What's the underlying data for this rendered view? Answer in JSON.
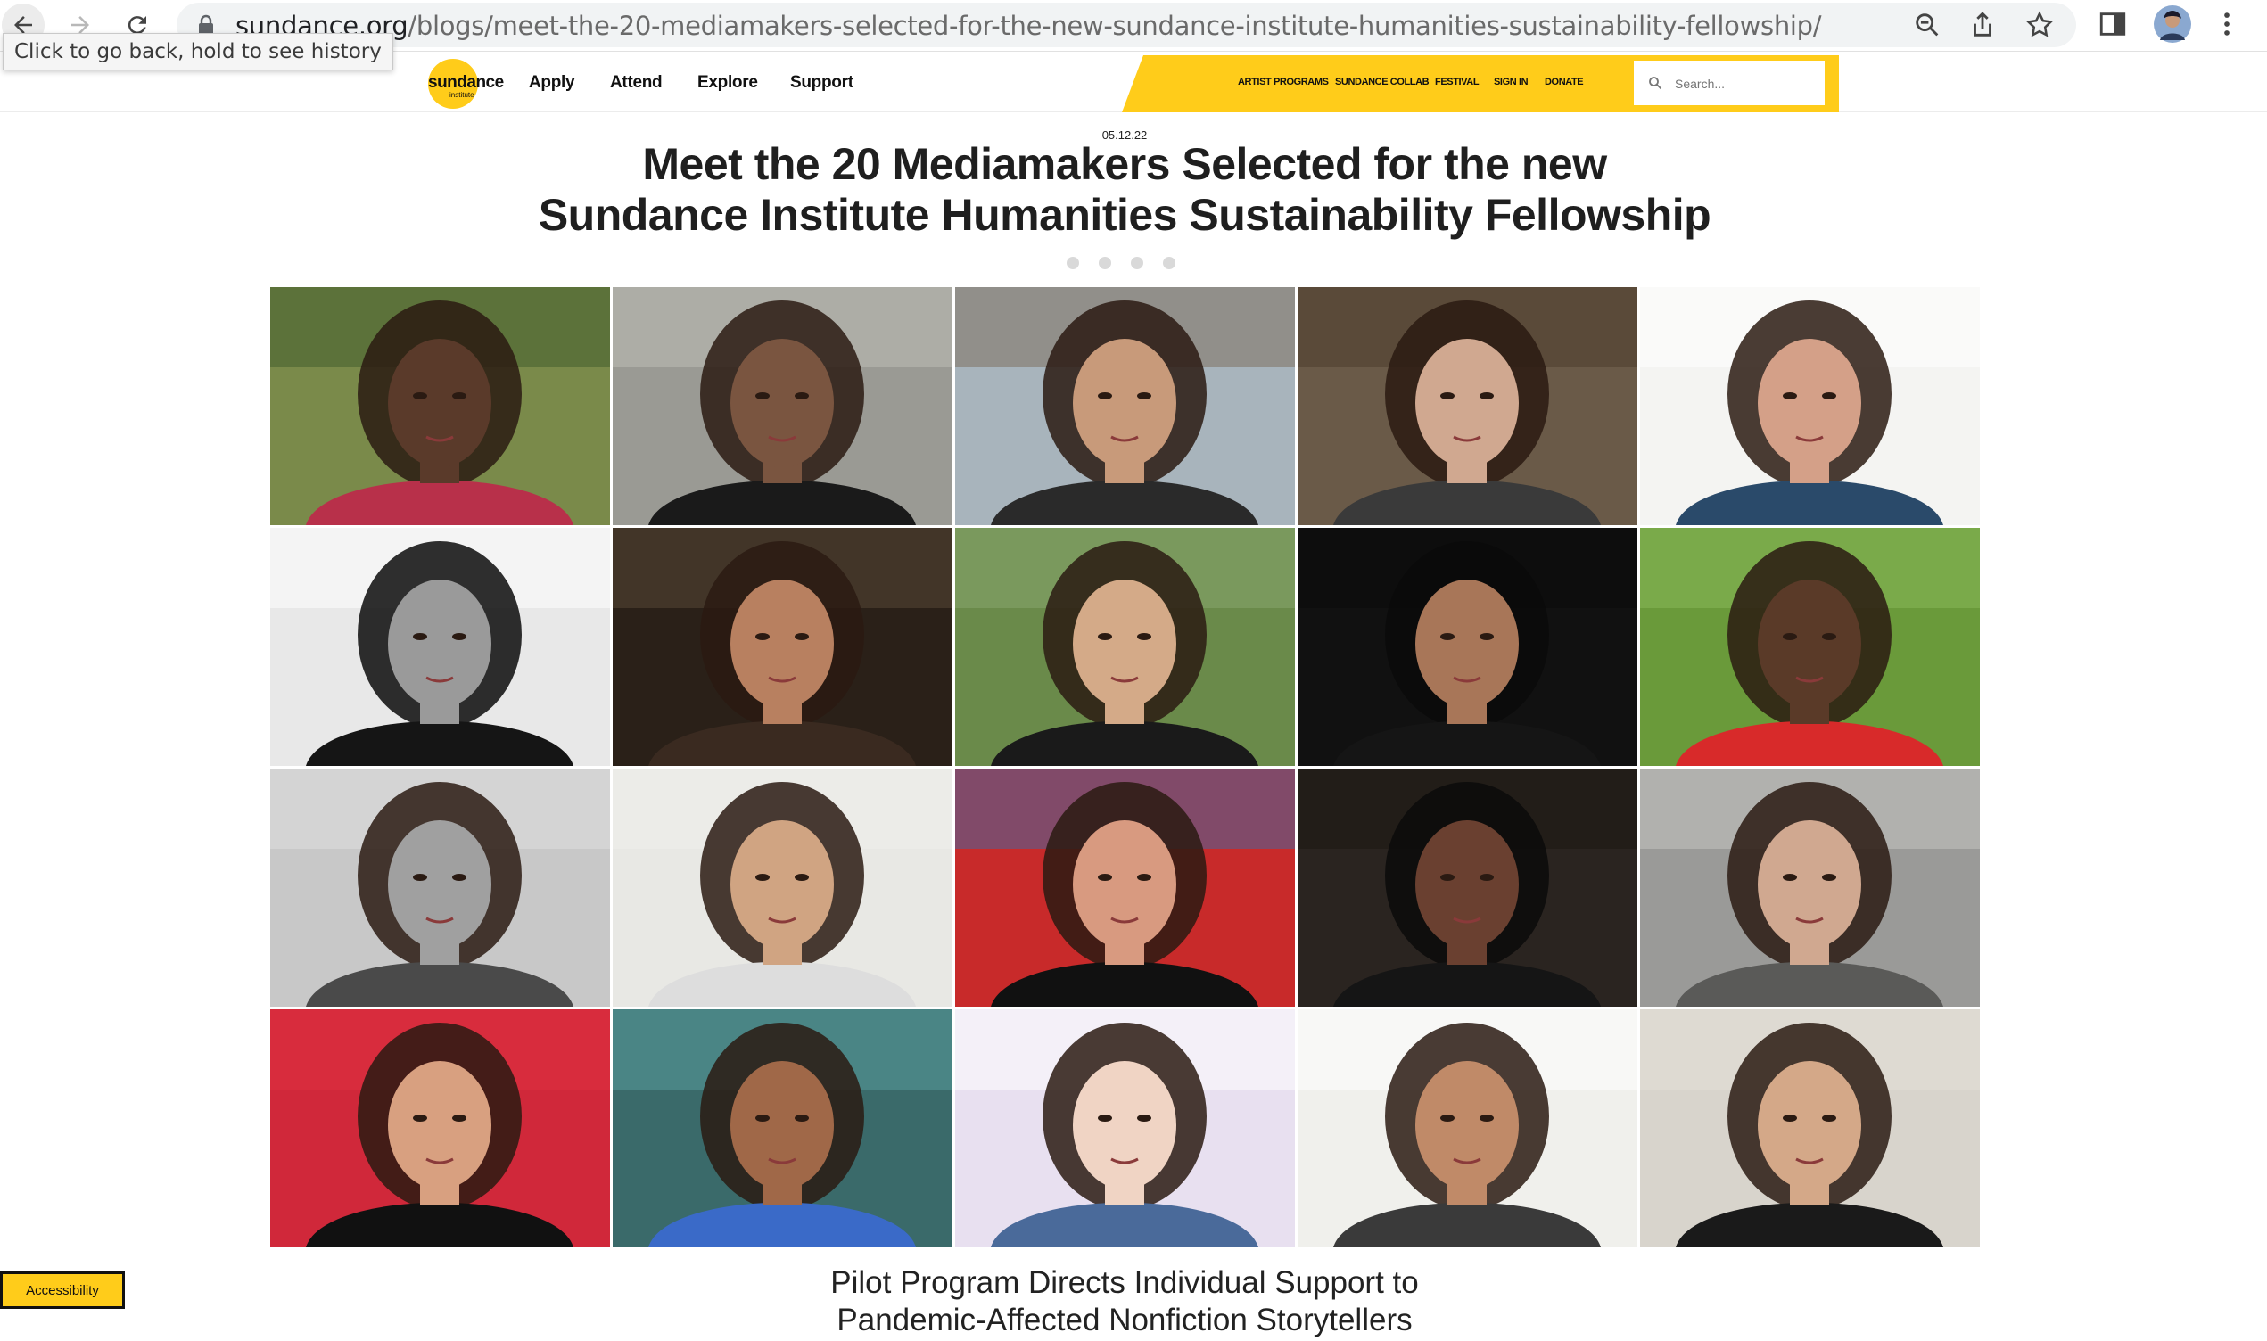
{
  "browser": {
    "url_host": "sundance.org",
    "url_path": "/blogs/meet-the-20-mediamakers-selected-for-the-new-sundance-institute-humanities-sustainability-fellowship/",
    "tooltip": "Click to go back, hold to see history"
  },
  "site": {
    "logo": "sundance",
    "logo_sub": "institute",
    "main_nav": [
      "Apply",
      "Attend",
      "Explore",
      "Support"
    ],
    "util_nav": [
      "ARTIST PROGRAMS",
      "SUNDANCE COLLAB",
      "FESTIVAL",
      "SIGN IN",
      "DONATE"
    ],
    "search_placeholder": "Search...",
    "accent_color": "#ffcc1a"
  },
  "article": {
    "date": "05.12.22",
    "title_line1": "Meet the 20 Mediamakers Selected for the new",
    "title_line2": "Sundance Institute Humanities Sustainability Fellowship",
    "share_icons": [
      "facebook-icon",
      "twitter-icon",
      "email-icon",
      "pinterest-icon"
    ],
    "subheading_line1": "Pilot Program Directs Individual Support to",
    "subheading_line2": "Pandemic-Affected Nonfiction Storytellers"
  },
  "photos": [
    {
      "bg": "#7a8a4a",
      "fg": "#5a3a2a",
      "top": "#3e5a2a",
      "shirt": "#b8304a"
    },
    {
      "bg": "#9a9a94",
      "fg": "#7a5540",
      "top": "#c0c0b8",
      "shirt": "#1a1a1a"
    },
    {
      "bg": "#a8b4bc",
      "fg": "#c89a7a",
      "top": "#7a6a58",
      "shirt": "#2a2a2a"
    },
    {
      "bg": "#6a5a48",
      "fg": "#d0a890",
      "top": "#4a3a2a",
      "shirt": "#3a3a3a"
    },
    {
      "bg": "#f4f4f2",
      "fg": "#d4a088",
      "top": "#ffffff",
      "shirt": "#2a4a6a"
    },
    {
      "bg": "#e8e8e8",
      "fg": "#9a9a9a",
      "top": "#ffffff",
      "shirt": "#151515"
    },
    {
      "bg": "#2a2018",
      "fg": "#b88060",
      "top": "#5a4a38",
      "shirt": "#3a2a20"
    },
    {
      "bg": "#6a8a4a",
      "fg": "#d4aa88",
      "top": "#8aa870",
      "shirt": "#1a1a1a"
    },
    {
      "bg": "#111111",
      "fg": "#a87658",
      "top": "#0a0a0a",
      "shirt": "#151515"
    },
    {
      "bg": "#6a9a3a",
      "fg": "#5a3a28",
      "top": "#8aba5a",
      "shirt": "#d82a2a"
    },
    {
      "bg": "#c8c8c8",
      "fg": "#a0a0a0",
      "top": "#e0e0e0",
      "shirt": "#4a4a4a"
    },
    {
      "bg": "#e8e8e4",
      "fg": "#d0a482",
      "top": "#f0f0ec",
      "shirt": "#dddddd"
    },
    {
      "bg": "#c82a2a",
      "fg": "#d89a80",
      "top": "#3a6aa8",
      "shirt": "#111111"
    },
    {
      "bg": "#2a2420",
      "fg": "#6a4030",
      "top": "#1a1510",
      "shirt": "#151515"
    },
    {
      "bg": "#9a9a98",
      "fg": "#d0a890",
      "top": "#c8c8c4",
      "shirt": "#5a5a58"
    },
    {
      "bg": "#d0283a",
      "fg": "#d8a080",
      "top": "#e03040",
      "shirt": "#111111"
    },
    {
      "bg": "#3a6a6a",
      "fg": "#a06848",
      "top": "#5aa0a0",
      "shirt": "#3a6ac8"
    },
    {
      "bg": "#e8e0f0",
      "fg": "#f0d4c4",
      "top": "#ffffff",
      "shirt": "#4a6a9a"
    },
    {
      "bg": "#f0f0ec",
      "fg": "#c08a68",
      "top": "#ffffff",
      "shirt": "#3a3a3a"
    },
    {
      "bg": "#d8d4cc",
      "fg": "#d4a888",
      "top": "#e4e0d8",
      "shirt": "#1a1a1a"
    }
  ]
}
